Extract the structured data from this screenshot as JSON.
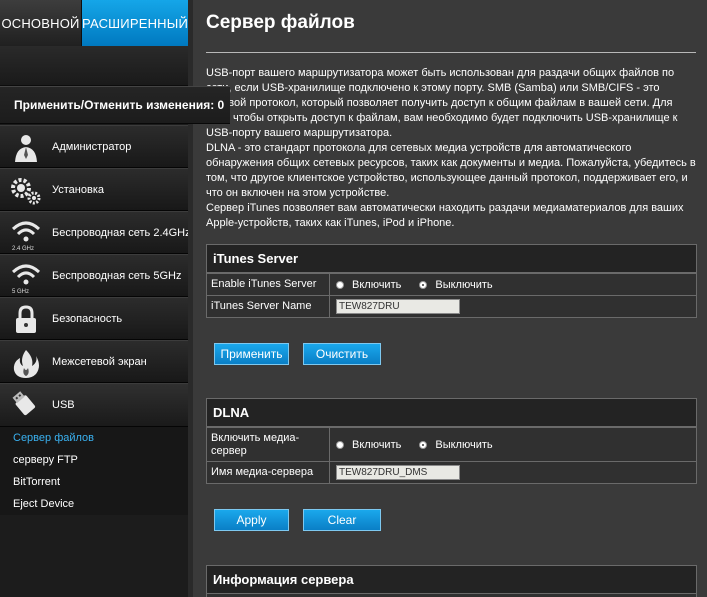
{
  "tabs": {
    "basic": "ОСНОВНОЙ",
    "advanced": "РАСШИРЕННЫЙ"
  },
  "apply_changes": "Применить/Отменить изменения: 0",
  "menu": [
    {
      "label": "Администратор",
      "icon": "admin-icon"
    },
    {
      "label": "Установка",
      "icon": "gears-icon"
    },
    {
      "label": "Беспроводная сеть 2.4GHz",
      "icon": "wifi-icon",
      "sub": "2.4 GHz"
    },
    {
      "label": "Беспроводная сеть 5GHz",
      "icon": "wifi-icon",
      "sub": "5 GHz"
    },
    {
      "label": "Безопасность",
      "icon": "lock-icon"
    },
    {
      "label": "Межсетевой экран",
      "icon": "fire-icon"
    },
    {
      "label": "USB",
      "icon": "usb-icon"
    }
  ],
  "usb_sub": [
    "Сервер файлов",
    "серверу FTP",
    "BitTorrent",
    "Eject Device"
  ],
  "page_title": "Сервер файлов",
  "description": [
    "USB-порт вашего маршрутизатора может быть использован для раздачи общих файлов по сети, если USB-хранилище подключено к этому порту. SMB (Samba) или SMB/CIFS - это сетевой протокол, который позволяет получить доступ к общим файлам в вашей сети. Для того, чтобы открыть доступ к файлам, вам необходимо будет подключить USB-хранилище к USB-порту вашего маршрутизатора.",
    "DLNA - это стандарт протокола для сетевых медиа устройств для автоматического обнаружения общих сетевых ресурсов, таких как документы и медиа. Пожалуйста, убедитесь в том, что другое клиентское устройство, использующее данный протокол, поддерживает его, и что он включен на этом устройстве.",
    "Сервер iTunes позволяет вам автоматически находить раздачи медиаматериалов для ваших Apple-устройств, таких как iTunes, iPod и iPhone."
  ],
  "itunes": {
    "title": "iTunes Server",
    "enable_label": "Enable iTunes Server",
    "enable_on": "Включить",
    "enable_off": "Выключить",
    "name_label": "iTunes Server Name",
    "name_value": "TEW827DRU",
    "apply": "Применить",
    "clear": "Очистить"
  },
  "dlna": {
    "title": "DLNA",
    "enable_label": "Включить медиа-сервер",
    "enable_on": "Включить",
    "enable_off": "Выключить",
    "name_label": "Имя медиа-сервера",
    "name_value": "TEW827DRU_DMS",
    "apply": "Apply",
    "clear": "Clear"
  },
  "server_info": {
    "title": "Информация сервера"
  },
  "colors": {
    "accent": "#0a8fd8",
    "active_link": "#3ab1f0",
    "background": "#3a3a3a"
  }
}
